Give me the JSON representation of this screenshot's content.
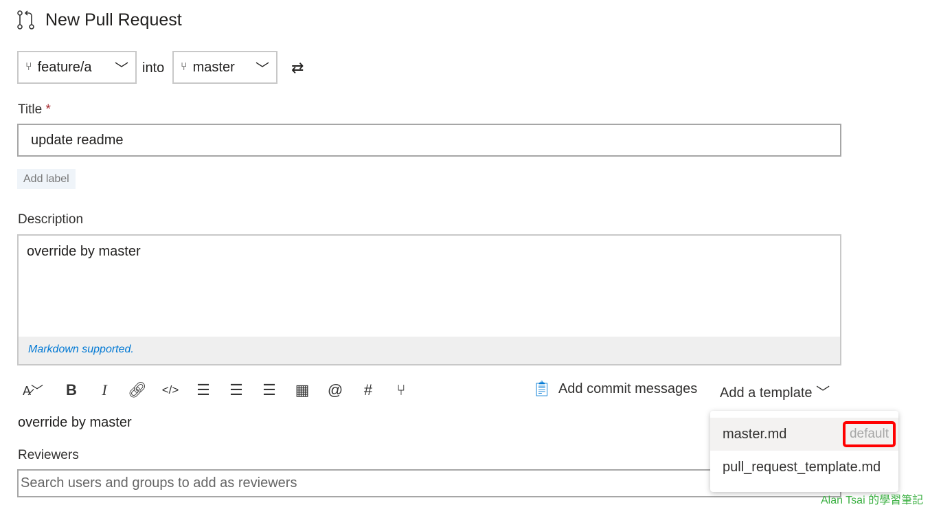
{
  "header": {
    "title": "New Pull Request",
    "icon": "pull-request-icon"
  },
  "branches": {
    "source": "feature/a",
    "into": "into",
    "target": "master"
  },
  "title_field": {
    "label": "Title",
    "required": "*",
    "value": "update readme"
  },
  "add_label": "Add label",
  "description": {
    "label": "Description",
    "value": "override by master",
    "hint": "Markdown supported."
  },
  "toolbar": {
    "add_commit_messages": "Add commit messages",
    "add_template": "Add a template"
  },
  "preview": "override by master",
  "reviewers": {
    "label": "Reviewers",
    "placeholder": "Search users and groups to add as reviewers"
  },
  "template_menu": [
    {
      "label": "master.md",
      "badge": "default"
    },
    {
      "label": "pull_request_template.md"
    }
  ],
  "watermark": "Alan Tsai 的學習筆記",
  "colors": {
    "accent": "#0078d4",
    "required": "#a4262c",
    "highlight": "#ff0000"
  }
}
